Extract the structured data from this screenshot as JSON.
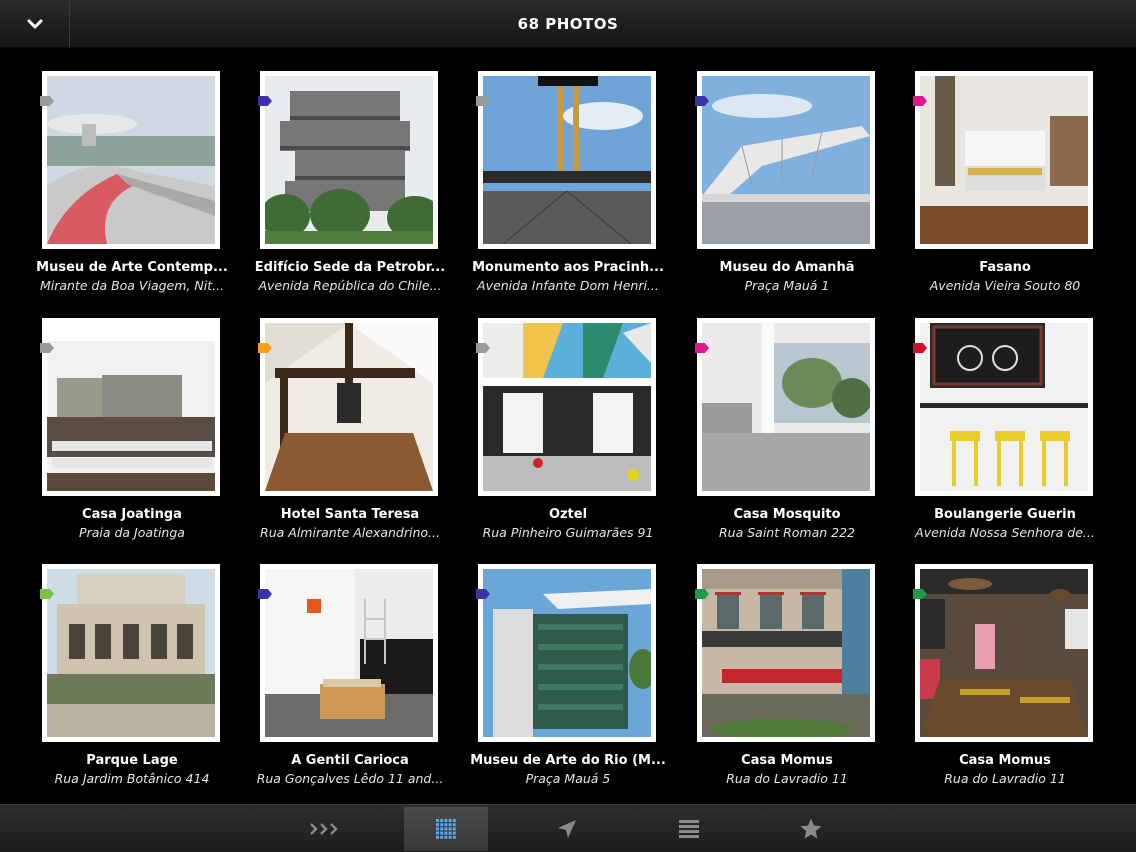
{
  "header": {
    "title": "68 PHOTOS",
    "back_icon": "chevron-down-icon"
  },
  "photos": [
    {
      "name": "Museu de Arte Contemp...",
      "address": "Mirante da Boa Viagem, Nit...",
      "tag_color": "#9a9a9a",
      "scene": "museum-ufo"
    },
    {
      "name": "Edifício Sede da Petrobr...",
      "address": "Avenida República do Chile...",
      "tag_color": "#3b33a8",
      "scene": "petrobras"
    },
    {
      "name": "Monumento aos Pracinh...",
      "address": "Avenida Infante Dom Henri...",
      "tag_color": "#9a9a9a",
      "scene": "monument"
    },
    {
      "name": "Museu do Amanhã",
      "address": "Praça Mauá 1",
      "tag_color": "#3b33a8",
      "scene": "amanha"
    },
    {
      "name": "Fasano",
      "address": "Avenida Vieira Souto 80",
      "tag_color": "#e0198a",
      "scene": "hotel-room"
    },
    {
      "name": "Casa Joatinga",
      "address": "Praia da Joatinga",
      "tag_color": "#9a9a9a",
      "scene": "modern-house"
    },
    {
      "name": "Hotel Santa Teresa",
      "address": "Rua Almirante Alexandrino...",
      "tag_color": "#f5a01a",
      "scene": "attic"
    },
    {
      "name": "Oztel",
      "address": "Rua Pinheiro Guimarães 91",
      "tag_color": "#9a9a9a",
      "scene": "oztel"
    },
    {
      "name": "Casa Mosquito",
      "address": "Rua Saint Roman 222",
      "tag_color": "#e0198a",
      "scene": "terrace"
    },
    {
      "name": "Boulangerie Guerin",
      "address": "Avenida Nossa Senhora de...",
      "tag_color": "#d0102a",
      "scene": "bakery"
    },
    {
      "name": "Parque Lage",
      "address": "Rua Jardim Botânico 414",
      "tag_color": "#7fc242",
      "scene": "palace"
    },
    {
      "name": "A Gentil Carioca",
      "address": "Rua Gonçalves Lêdo 11 and...",
      "tag_color": "#3b33a8",
      "scene": "gallery"
    },
    {
      "name": "Museu de Arte do Rio (M...",
      "address": "Praça Mauá 5",
      "tag_color": "#3b33a8",
      "scene": "mar"
    },
    {
      "name": "Casa Momus",
      "address": "Rua do Lavradio 11",
      "tag_color": "#1f9a48",
      "scene": "facade"
    },
    {
      "name": "Casa Momus",
      "address": "Rua do Lavradio 11",
      "tag_color": "#1f9a48",
      "scene": "restaurant"
    }
  ],
  "toolbar": {
    "items": [
      {
        "name": "chevrons-right-icon",
        "active": false
      },
      {
        "name": "grid-icon",
        "active": true
      },
      {
        "name": "location-arrow-icon",
        "active": false
      },
      {
        "name": "list-icon",
        "active": false
      },
      {
        "name": "star-icon",
        "active": false
      }
    ]
  }
}
